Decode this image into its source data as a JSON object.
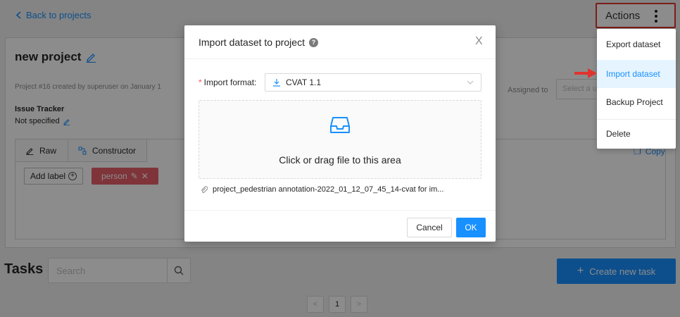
{
  "header": {
    "back_label": "Back to projects",
    "actions_label": "Actions"
  },
  "project": {
    "title": "new project",
    "meta": "Project #16 created by superuser on January 1",
    "issue_tracker_label": "Issue Tracker",
    "issue_tracker_value": "Not specified",
    "assigned_to_label": "Assigned to",
    "assignee_placeholder": "Select a u"
  },
  "labels": {
    "tabs": [
      "Raw",
      "Constructor"
    ],
    "copy_label": "Copy",
    "add_label": "Add label",
    "tags": [
      "person"
    ]
  },
  "tasks": {
    "heading": "Tasks",
    "search_placeholder": "Search",
    "create_label": "Create new task",
    "pagination": {
      "prev": "<",
      "current": "1",
      "next": ">"
    }
  },
  "actions_menu": {
    "items": [
      "Export dataset",
      "Import dataset",
      "Backup Project",
      "Delete"
    ],
    "active_item": "Import dataset"
  },
  "modal": {
    "title": "Import dataset to project",
    "close_glyph": "X",
    "format_label": "Import format",
    "format_value": "CVAT 1.1",
    "dropzone_text": "Click or drag file to this area",
    "file_name": "project_pedestrian annotation-2022_01_12_07_45_14-cvat for im...",
    "cancel_label": "Cancel",
    "ok_label": "OK"
  },
  "colors": {
    "accent": "#1890ff",
    "highlight_red": "#e0332e",
    "tag_color": "#e85f6b"
  }
}
